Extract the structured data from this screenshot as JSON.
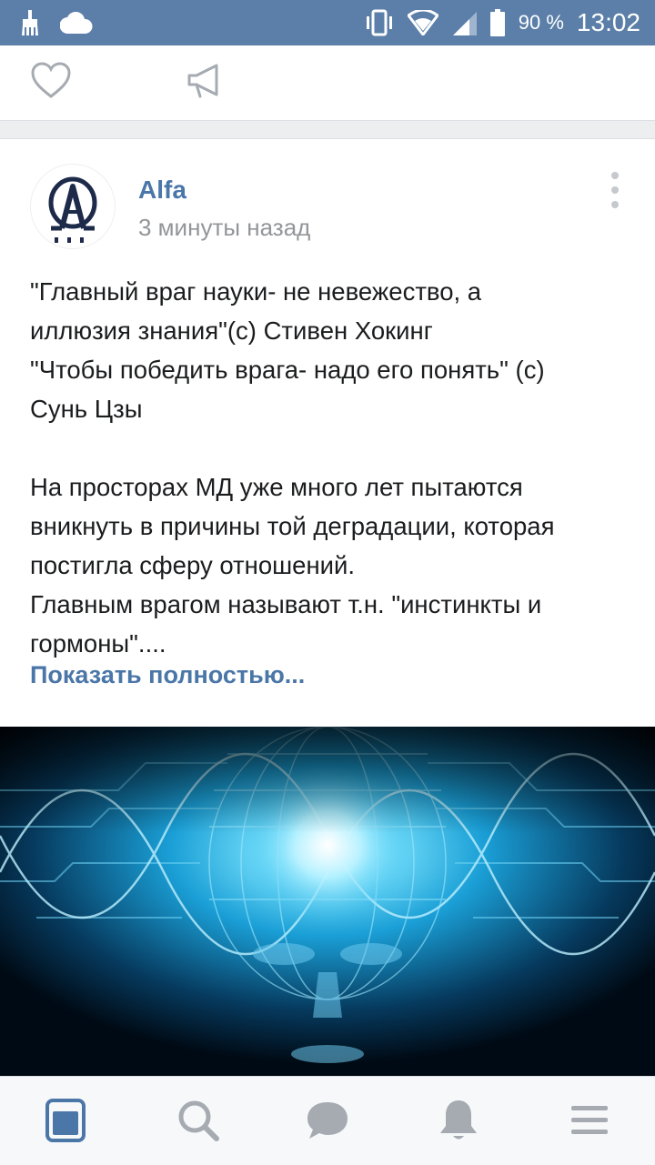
{
  "status_bar": {
    "battery_percent": "90 %",
    "time": "13:02",
    "icons": [
      "cleaner-icon",
      "cloud-icon",
      "vibrate-icon",
      "wifi-icon",
      "signal-icon",
      "battery-icon"
    ]
  },
  "top_actions": {
    "icons": [
      "heart-icon",
      "megaphone-icon"
    ]
  },
  "post": {
    "author": "Alfa",
    "time_ago": "3 минуты назад",
    "lines": [
      "\"Главный враг науки- не невежество, а",
      "иллюзия знания\"(с) Стивен Хокинг",
      "\"Чтобы победить врага- надо его понять\" (с)",
      "Сунь Цзы",
      "",
      "На просторах МД уже много лет пытаются",
      "вникнуть в причины той деградации, которая",
      "постигла сферу отношений.",
      "Главным врагом называют т.н. \"инстинкты и",
      "гормоны\"...."
    ],
    "show_more": "Показать полностью..."
  },
  "bottom_nav": {
    "items": [
      "news-icon",
      "search-icon",
      "messages-icon",
      "notifications-icon",
      "menu-icon"
    ],
    "active": "news-icon"
  },
  "colors": {
    "status_bar": "#5b7fa8",
    "accent": "#4a76a8",
    "text": "#1b1c1e",
    "muted": "#939699",
    "nav_icon": "#a6abb2"
  }
}
